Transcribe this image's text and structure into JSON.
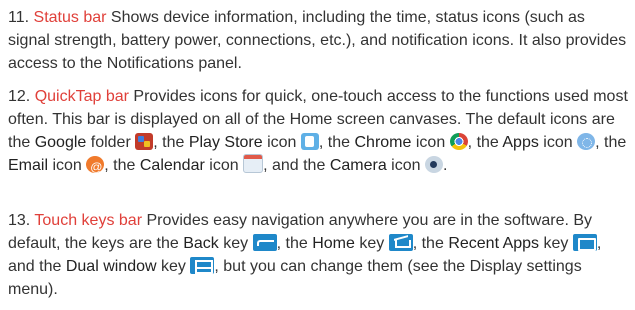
{
  "items": [
    {
      "number": "11.",
      "term": "Status bar",
      "text": "Shows device information, including the time, status icons (such as signal strength, battery power, connections, etc.), and notification icons. It also provides access to the Notifications panel."
    },
    {
      "number": "12.",
      "term": "QuickTap bar",
      "text1": "Provides icons for quick, one-touch access to the functions used most often. This bar is displayed on all of the Home screen canvases. The default icons are the",
      "google": "Google",
      "text2": "folder",
      "text3": ", the",
      "play_store": "Play Store",
      "text4": "icon",
      "text5": ", the",
      "chrome": "Chrome",
      "text6": "icon",
      "text7": ", the",
      "apps": "Apps",
      "text8": "icon",
      "text9": ", the",
      "email": "Email",
      "text10": "icon",
      "text11": ", the",
      "calendar": "Calendar",
      "text12": "icon",
      "text13": ", and the",
      "camera": "Camera",
      "text14": "icon",
      "text15": "."
    },
    {
      "number": "13.",
      "term": "Touch keys bar",
      "text1": "Provides easy navigation anywhere you are in the software. By default, the keys are the",
      "back": "Back",
      "text2": "key",
      "text3": ", the",
      "home": "Home",
      "text4": "key",
      "text5": ", the",
      "recent": "Recent Apps",
      "text6": "key",
      "text7": ", and the",
      "dual": "Dual window",
      "text8": "key",
      "text9": ", but you can change them (see the Display settings menu)."
    }
  ],
  "icons": [
    "google-folder-icon",
    "play-store-icon",
    "chrome-icon",
    "apps-icon",
    "email-icon",
    "calendar-icon",
    "camera-icon",
    "back-key-icon",
    "home-key-icon",
    "recent-apps-key-icon",
    "dual-window-key-icon"
  ]
}
